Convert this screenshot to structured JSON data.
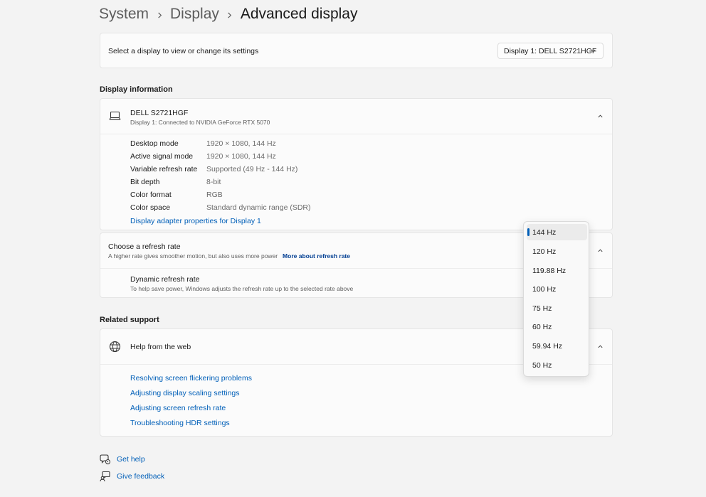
{
  "breadcrumb": {
    "items": [
      "System",
      "Display"
    ],
    "current": "Advanced display"
  },
  "select_display": {
    "label": "Select a display to view or change its settings",
    "selected": "Display 1: DELL S2721HGF"
  },
  "display_information": {
    "section_title": "Display information",
    "monitor_name": "DELL S2721HGF",
    "monitor_sub": "Display 1: Connected to NVIDIA GeForce RTX 5070",
    "rows": [
      {
        "label": "Desktop mode",
        "value": "1920 × 1080, 144 Hz"
      },
      {
        "label": "Active signal mode",
        "value": "1920 × 1080, 144 Hz"
      },
      {
        "label": "Variable refresh rate",
        "value": "Supported (49 Hz - 144 Hz)"
      },
      {
        "label": "Bit depth",
        "value": "8-bit"
      },
      {
        "label": "Color format",
        "value": "RGB"
      },
      {
        "label": "Color space",
        "value": "Standard dynamic range (SDR)"
      }
    ],
    "adapter_link": "Display adapter properties for Display 1"
  },
  "refresh_rate": {
    "title": "Choose a refresh rate",
    "subtitle": "A higher rate gives smoother motion, but also uses more power",
    "more_link": "More about refresh rate",
    "dynamic_title": "Dynamic refresh rate",
    "dynamic_sub": "To help save power, Windows adjusts the refresh rate up to the selected rate above"
  },
  "dropdown": {
    "options": [
      "144 Hz",
      "120 Hz",
      "119.88 Hz",
      "100 Hz",
      "75 Hz",
      "60 Hz",
      "59.94 Hz",
      "50 Hz"
    ],
    "selected": "144 Hz"
  },
  "related_support": {
    "section_title": "Related support",
    "help_title": "Help from the web",
    "links": [
      "Resolving screen flickering problems",
      "Adjusting display scaling settings",
      "Adjusting screen refresh rate",
      "Troubleshooting HDR settings"
    ]
  },
  "footer": {
    "get_help": "Get help",
    "give_feedback": "Give feedback"
  },
  "icons": {
    "monitor": "laptop-icon",
    "globe": "globe-icon",
    "help": "get-help-icon",
    "feedback": "feedback-icon"
  },
  "colors": {
    "accent": "#005fb8",
    "background": "#f3f3f3",
    "card": "#fbfbfb"
  }
}
